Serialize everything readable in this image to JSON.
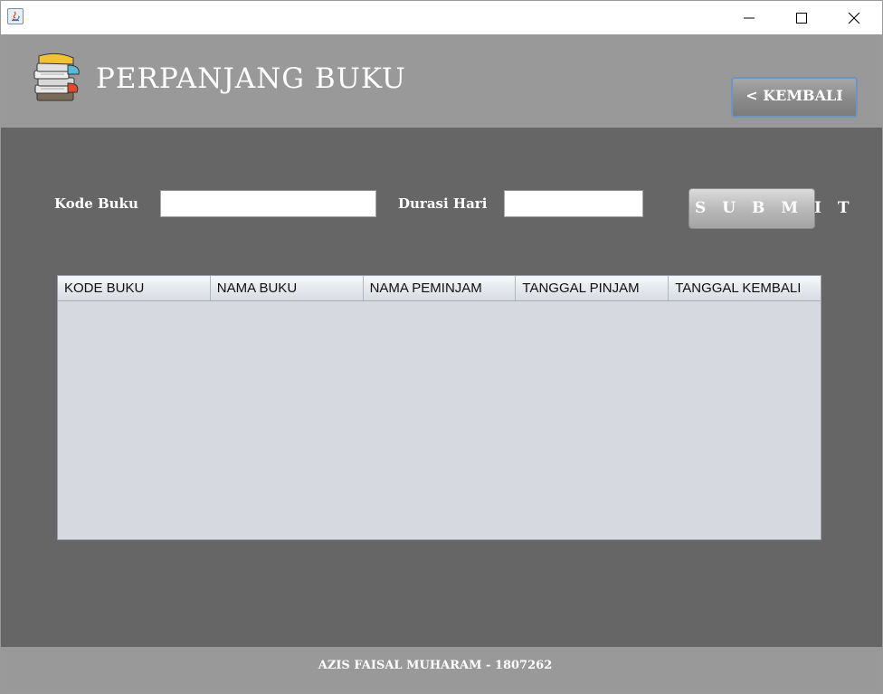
{
  "window": {
    "app_icon": "java-icon",
    "controls": {
      "minimize": "minimize-icon",
      "maximize": "maximize-icon",
      "close": "close-icon"
    }
  },
  "header": {
    "logo": "books-stack-icon",
    "title": "PERPANJANG BUKU",
    "back_label": "< KEMBALI"
  },
  "form": {
    "kode_buku_label": "Kode Buku",
    "kode_buku_value": "",
    "durasi_hari_label": "Durasi Hari",
    "durasi_hari_value": "",
    "submit_label": "S U B M I T"
  },
  "table": {
    "columns": [
      "KODE BUKU",
      "NAMA BUKU",
      "NAMA PEMINJAM",
      "TANGGAL PINJAM",
      "TANGGAL KEMBALI"
    ],
    "rows": []
  },
  "footer": {
    "text": "AZIS FAISAL MUHARAM - 1807262"
  },
  "colors": {
    "body_background": "#666666",
    "header_background": "#999999",
    "table_background": "#d6d9e0",
    "back_button_border": "#6f95bf"
  }
}
